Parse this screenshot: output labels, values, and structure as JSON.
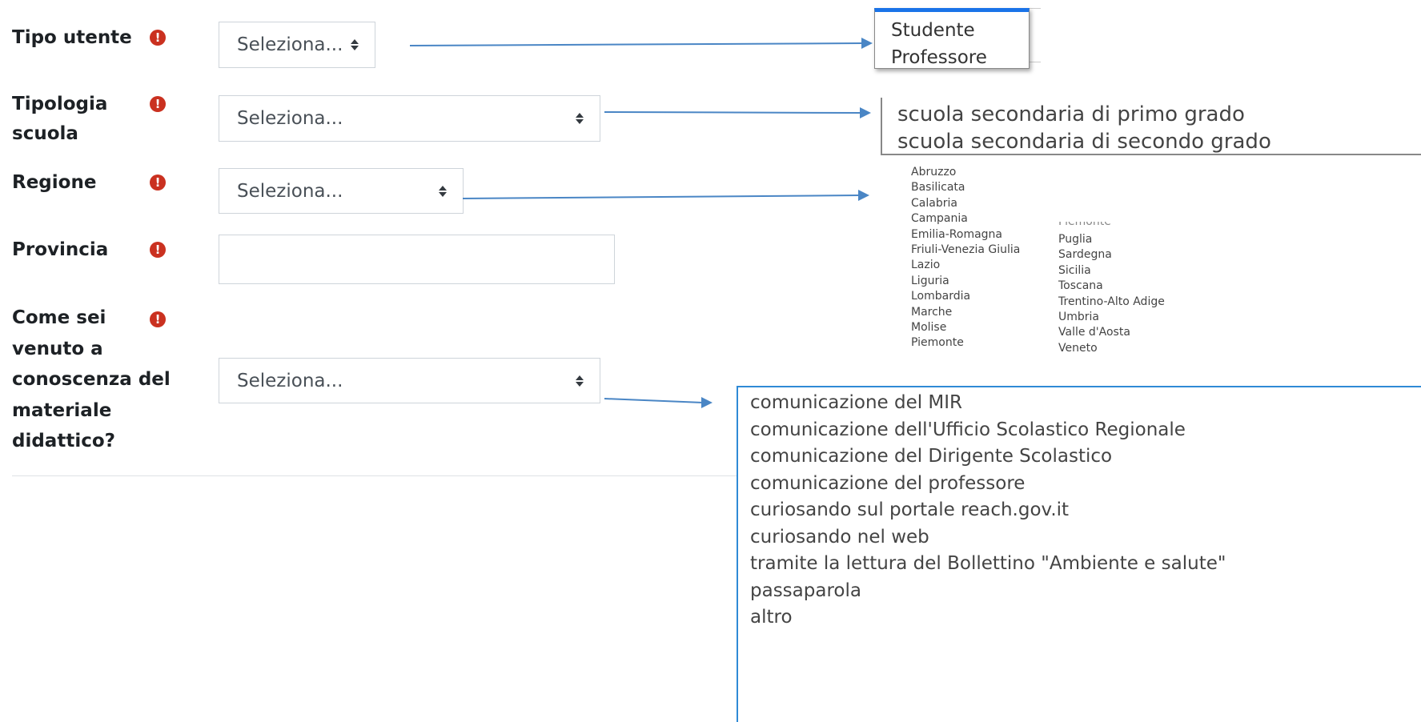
{
  "form": {
    "tipo_utente": {
      "label": "Tipo utente",
      "placeholder": "Seleziona..."
    },
    "tipologia_scuola": {
      "label_line1": "Tipologia",
      "label_line2": "scuola",
      "placeholder": "Seleziona..."
    },
    "regione": {
      "label": "Regione",
      "placeholder": "Seleziona..."
    },
    "provincia": {
      "label": "Provincia",
      "value": ""
    },
    "come_sei_venuto": {
      "label_lines": [
        "Come sei",
        "venuto a",
        "conoscenza del",
        "materiale",
        "didattico?"
      ],
      "placeholder": "Seleziona..."
    },
    "required_icon": "exclamation-circle-icon",
    "required_color": "#ca3120"
  },
  "dropdowns": {
    "tipo_utente_options": [
      "Studente",
      "Professore"
    ],
    "tipologia_scuola_options": [
      "scuola secondaria di primo grado",
      "scuola secondaria di secondo grado"
    ],
    "regione_options_col1": [
      "Abruzzo",
      "Basilicata",
      "Calabria",
      "Campania",
      "Emilia-Romagna",
      "Friuli-Venezia Giulia",
      "Lazio",
      "Liguria",
      "Lombardia",
      "Marche",
      "Molise",
      "Piemonte"
    ],
    "regione_cut_option": "Piemonte",
    "regione_options_col2": [
      "Puglia",
      "Sardegna",
      "Sicilia",
      "Toscana",
      "Trentino-Alto Adige",
      "Umbria",
      "Valle d'Aosta",
      "Veneto"
    ],
    "come_sei_venuto_options": [
      "comunicazione del MIR",
      "comunicazione dell'Ufficio Scolastico Regionale",
      "comunicazione del Dirigente Scolastico",
      "comunicazione del professore",
      "curiosando sul portale reach.gov.it",
      "curiosando nel web",
      "tramite la lettura del Bollettino \"Ambiente e salute\"",
      "passaparola",
      "altro"
    ]
  },
  "colors": {
    "arrow": "#4a86c5",
    "dropdown_highlight": "#1a73e8",
    "dropdown_border_blue": "#2f8ad6"
  }
}
